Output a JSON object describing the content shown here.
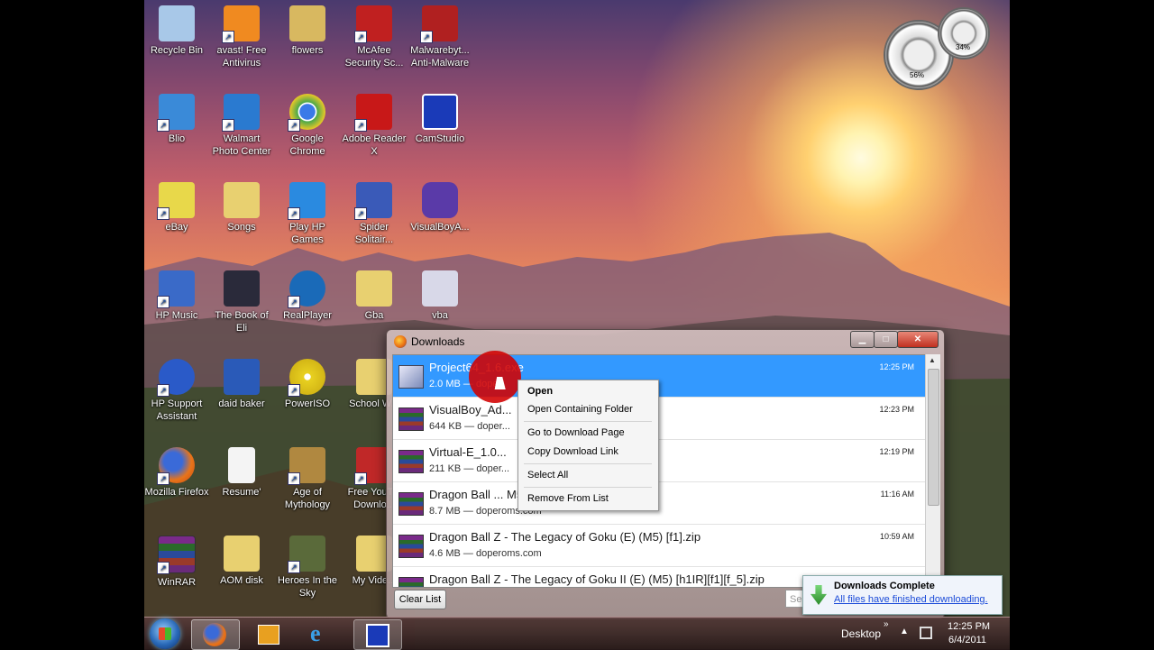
{
  "desktop_icons": [
    {
      "label": "Recycle Bin",
      "color": "#a8c8e8"
    },
    {
      "label": "avast! Free Antivirus",
      "color": "#f08a20"
    },
    {
      "label": "flowers",
      "color": "#d8b860"
    },
    {
      "label": "McAfee Security Sc...",
      "color": "#c02020"
    },
    {
      "label": "Malwarebyt... Anti-Malware",
      "color": "#b02020"
    },
    {
      "label": "Blio",
      "color": "#3a8ad8"
    },
    {
      "label": "Walmart Photo Center",
      "color": "#2a7ad0"
    },
    {
      "label": "Google Chrome",
      "color": "#4aa84a"
    },
    {
      "label": "Adobe Reader X",
      "color": "#c81818"
    },
    {
      "label": "CamStudio",
      "color": "#1a3ab8"
    },
    {
      "label": "eBay",
      "color": "#e8d84a"
    },
    {
      "label": "Songs",
      "color": "#e8d070"
    },
    {
      "label": "Play HP Games",
      "color": "#2a8ae0"
    },
    {
      "label": "Spider Solitair...",
      "color": "#3a5ab8"
    },
    {
      "label": "VisualBoyA...",
      "color": "#5a3aa8"
    },
    {
      "label": "HP Music",
      "color": "#3a6ac8"
    },
    {
      "label": "The Book of Eli",
      "color": "#2a2a3a"
    },
    {
      "label": "RealPlayer",
      "color": "#1a6ab8"
    },
    {
      "label": "Gba",
      "color": "#e8d070"
    },
    {
      "label": "vba",
      "color": "#d8d8e8"
    },
    {
      "label": "HP Support Assistant",
      "color": "#2a5ac8"
    },
    {
      "label": "daid baker",
      "color": "#2a5ab8"
    },
    {
      "label": "PowerISO",
      "color": "#e8d020"
    },
    {
      "label": "School W...",
      "color": "#e8d070"
    },
    {
      "label": "Mozilla Firefox",
      "color": "#e8741a"
    },
    {
      "label": "Resume'",
      "color": "#f4f4f4"
    },
    {
      "label": "Age of Mythology",
      "color": "#b08840"
    },
    {
      "label": "Free YouT... Downlo...",
      "color": "#c02828"
    },
    {
      "label": "WinRAR",
      "color": "#7a2a8a"
    },
    {
      "label": "AOM disk",
      "color": "#e8d070"
    },
    {
      "label": "Heroes In the Sky",
      "color": "#5a6a3a"
    },
    {
      "label": "My Vide...",
      "color": "#e8d070"
    }
  ],
  "gadget": {
    "cpu": "56%",
    "mem": "34%"
  },
  "downloads_window": {
    "title": "Downloads",
    "items": [
      {
        "name": "Project64_1.6.exe",
        "meta": "2.0 MB — dope...",
        "time": "12:25 PM",
        "selected": true,
        "icon": "exe-icon"
      },
      {
        "name": "VisualBoy_Ad...",
        "meta": "644 KB — doper...",
        "time": "12:23 PM",
        "selected": false,
        "icon": "rar-icon"
      },
      {
        "name": "Virtual-E_1.0...",
        "meta": "211 KB — doper...",
        "time": "12:19 PM",
        "selected": false,
        "icon": "rar-icon"
      },
      {
        "name": "Dragon Ball ... M5).zip",
        "meta": "8.7 MB — doperoms.com",
        "time": "11:16 AM",
        "selected": false,
        "icon": "rar-icon"
      },
      {
        "name": "Dragon Ball Z - The Legacy of Goku (E) (M5) [f1].zip",
        "meta": "4.6 MB — doperoms.com",
        "time": "10:59 AM",
        "selected": false,
        "icon": "rar-icon"
      },
      {
        "name": "Dragon Ball Z - The Legacy of Goku II (E) (M5) [h1IR][f1][f_5].zip",
        "meta": "",
        "time": "",
        "selected": false,
        "icon": "rar-icon"
      }
    ],
    "clear_list_label": "Clear List",
    "search_placeholder": "Sea..."
  },
  "context_menu": {
    "items": [
      "Open",
      "Open Containing Folder",
      "Go to Download Page",
      "Copy Download Link",
      "Select All",
      "Remove From List"
    ]
  },
  "notification": {
    "title": "Downloads Complete",
    "link": "All files have finished downloading."
  },
  "taskbar": {
    "desktop_label": "Desktop",
    "time": "12:25 PM",
    "date": "6/4/2011"
  }
}
